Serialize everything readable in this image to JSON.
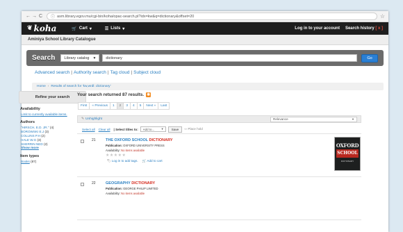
{
  "browser": {
    "url": "asm.library.egov.mu/cgi-bin/koha/opac-search.pl?idx=kw&q=dictionary&offset=20"
  },
  "topnav": {
    "logo": "koha",
    "cart": "Cart",
    "lists": "Lists",
    "login": "Log in to your account",
    "history": "Search history",
    "history_close": "[ x ]"
  },
  "library_name": "Aminiya School Library Catalogue",
  "search": {
    "label": "Search",
    "scope": "Library catalog",
    "query": "dictionary",
    "go": "Go"
  },
  "more_links": {
    "advanced": "Advanced search",
    "authority": "Authority search",
    "tag_cloud": "Tag cloud",
    "subject_cloud": "Subject cloud"
  },
  "breadcrumb": {
    "home": "Home",
    "results": "Results of search for 'kw,wrdl: dictionary'"
  },
  "refine": {
    "title": "Refine your search",
    "availability_heading": "Availability",
    "availability_link": "Limit to currently available items.",
    "authors_heading": "Authors",
    "authors": [
      {
        "name": "\"HIRSCH, E.D. JR.\"",
        "count": "(4)"
      },
      {
        "name": "BOROWSKI E.J",
        "count": "(3)"
      },
      {
        "name": "COLLINS P.H",
        "count": "(2)"
      },
      {
        "name": "HALE W.G",
        "count": "(3)"
      },
      {
        "name": "SHERRIN NED",
        "count": "(2)"
      }
    ],
    "show_more": "Show more",
    "itemtypes_heading": "Item types",
    "itemtypes": [
      {
        "name": "Books",
        "count": "(87)"
      }
    ]
  },
  "results": {
    "count_text": "Your search returned 87 results.",
    "pages": [
      "First",
      "« Previous",
      "1",
      "2",
      "3",
      "4",
      "5",
      "Next »",
      "Last"
    ],
    "current_page": "2",
    "unhighlight": "Unhighlight",
    "sort": "Relevance",
    "select_all": "Select all",
    "clear_all": "Clear all",
    "select_titles": "Select titles to:",
    "add_to": "Add to...",
    "save": "Save",
    "place_hold": "Place hold"
  },
  "records": [
    {
      "num": "21",
      "title_prefix": "THE OXFORD SCHOOL ",
      "title_hl": "DICTIONARY",
      "pub_label": "Publication:",
      "publisher": "OXFORD UNIVERSITY PRESS",
      "avail_label": "Availability:",
      "avail_value": "No items available",
      "stars": "★★★★★",
      "tags": "Log in to add tags.",
      "cart": "Add to cart",
      "cover": {
        "line1": "OXFORD",
        "line2": "SCHOOL",
        "line3": "DICTIONARY"
      }
    },
    {
      "num": "22",
      "title_prefix": "GEOGRAPHY ",
      "title_hl": "DICTIONARY",
      "pub_label": "Publication:",
      "publisher": "GEORGE PHILIP LIMITED",
      "avail_label": "Availability:",
      "avail_value": "No items available"
    }
  ]
}
